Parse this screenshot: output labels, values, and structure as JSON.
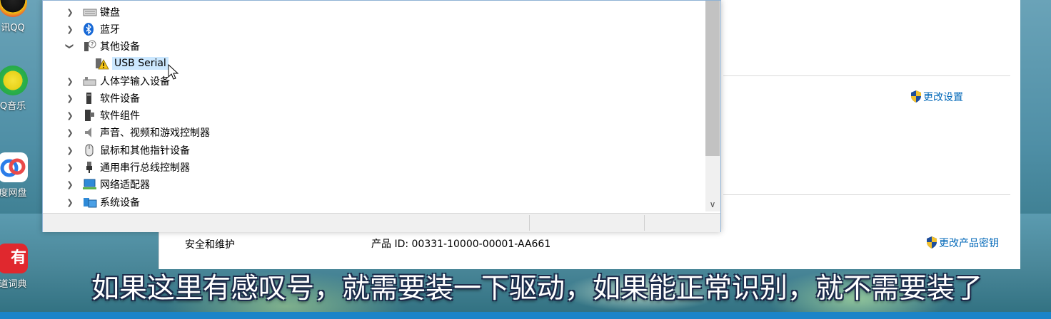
{
  "desktop": {
    "icons": [
      {
        "label": "讯QQ",
        "icon": "qq-icon"
      },
      {
        "label": "Q音乐",
        "icon": "qq-music-icon"
      },
      {
        "label": "度网盘",
        "icon": "baidu-netdisk-icon"
      },
      {
        "label": "道词典",
        "icon": "youdao-dict-icon"
      }
    ],
    "youdao_glyph": "有道"
  },
  "device_manager": {
    "tree": [
      {
        "label": "键盘",
        "expanded": false,
        "icon": "keyboard-icon"
      },
      {
        "label": "蓝牙",
        "expanded": false,
        "icon": "bluetooth-icon"
      },
      {
        "label": "其他设备",
        "expanded": true,
        "icon": "unknown-device-icon"
      },
      {
        "label": "USB Serial",
        "child": true,
        "selected": true,
        "icon": "warning-device-icon"
      },
      {
        "label": "人体学输入设备",
        "expanded": false,
        "icon": "hid-icon"
      },
      {
        "label": "软件设备",
        "expanded": false,
        "icon": "software-device-icon"
      },
      {
        "label": "软件组件",
        "expanded": false,
        "icon": "software-component-icon"
      },
      {
        "label": "声音、视频和游戏控制器",
        "expanded": false,
        "icon": "speaker-icon"
      },
      {
        "label": "鼠标和其他指针设备",
        "expanded": false,
        "icon": "mouse-icon"
      },
      {
        "label": "通用串行总线控制器",
        "expanded": false,
        "icon": "usb-icon"
      },
      {
        "label": "网络适配器",
        "expanded": false,
        "icon": "network-adapter-icon"
      },
      {
        "label": "系统设备",
        "expanded": false,
        "icon": "system-device-icon"
      }
    ]
  },
  "settings": {
    "change_settings_link": "更改设置",
    "security_label": "安全和维护",
    "product_id": "产品 ID: 00331-10000-00001-AA661",
    "change_product_key_link": "更改产品密钥"
  },
  "subtitle": "如果这里有感叹号，就需要装一下驱动，如果能正常识别，就不需要装了",
  "colors": {
    "link": "#0067b8",
    "selection": "#cce8ff",
    "taskbar_strip": "#1b84c8"
  }
}
